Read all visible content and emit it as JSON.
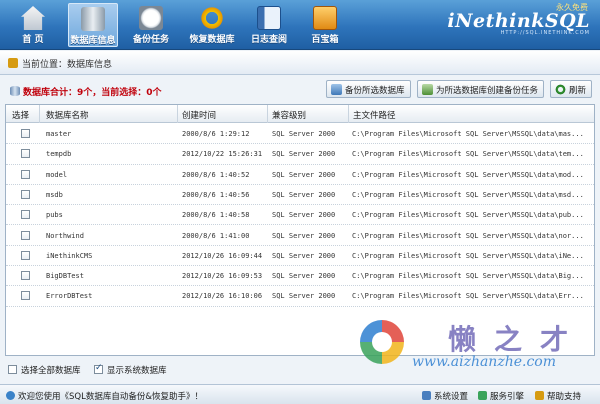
{
  "toolbar": {
    "items": [
      {
        "label": "首 页",
        "icon": "home-icon"
      },
      {
        "label": "数据库信息",
        "icon": "database-icon",
        "active": true
      },
      {
        "label": "备份任务",
        "icon": "clock-icon"
      },
      {
        "label": "恢复数据库",
        "icon": "restore-icon"
      },
      {
        "label": "日志查阅",
        "icon": "log-icon"
      },
      {
        "label": "百宝箱",
        "icon": "toolbox-icon"
      }
    ]
  },
  "brand": {
    "name": "iNethinkSQL",
    "slogan": "永久免费",
    "url": "HTTP://SQL.INETHINK.COM"
  },
  "location": {
    "text": "当前位置：数据库信息"
  },
  "summary": {
    "text": "数据库合计：9个，当前选择：0个"
  },
  "actions": {
    "backup_selected": "备份所选数据库",
    "create_task": "为所选数据库创建备份任务",
    "refresh": "刷新"
  },
  "table": {
    "columns": [
      "选择",
      "数据库名称",
      "创建时间",
      "兼容级别",
      "主文件路径"
    ],
    "rows": [
      {
        "name": "master",
        "created": "2000/8/6 1:29:12",
        "level": "SQL Server 2000",
        "path": "C:\\Program Files\\Microsoft SQL Server\\MSSQL\\data\\mas..."
      },
      {
        "name": "tempdb",
        "created": "2012/10/22 15:26:31",
        "level": "SQL Server 2000",
        "path": "C:\\Program Files\\Microsoft SQL Server\\MSSQL\\data\\tem..."
      },
      {
        "name": "model",
        "created": "2000/8/6 1:40:52",
        "level": "SQL Server 2000",
        "path": "C:\\Program Files\\Microsoft SQL Server\\MSSQL\\data\\mod..."
      },
      {
        "name": "msdb",
        "created": "2000/8/6 1:40:56",
        "level": "SQL Server 2000",
        "path": "C:\\Program Files\\Microsoft SQL Server\\MSSQL\\data\\msd..."
      },
      {
        "name": "pubs",
        "created": "2000/8/6 1:40:58",
        "level": "SQL Server 2000",
        "path": "C:\\Program Files\\Microsoft SQL Server\\MSSQL\\data\\pub..."
      },
      {
        "name": "Northwind",
        "created": "2000/8/6 1:41:00",
        "level": "SQL Server 2000",
        "path": "C:\\Program Files\\Microsoft SQL Server\\MSSQL\\data\\nor..."
      },
      {
        "name": "iNethinkCMS",
        "created": "2012/10/26 16:09:44",
        "level": "SQL Server 2000",
        "path": "C:\\Program Files\\Microsoft SQL Server\\MSSQL\\data\\iNe..."
      },
      {
        "name": "BigDBTest",
        "created": "2012/10/26 16:09:53",
        "level": "SQL Server 2000",
        "path": "C:\\Program Files\\Microsoft SQL Server\\MSSQL\\data\\Big..."
      },
      {
        "name": "ErrorDBTest",
        "created": "2012/10/26 16:10:06",
        "level": "SQL Server 2000",
        "path": "C:\\Program Files\\Microsoft SQL Server\\MSSQL\\data\\Err..."
      }
    ]
  },
  "options": {
    "select_all": {
      "label": "选择全部数据库",
      "checked": false
    },
    "show_system": {
      "label": "显示系统数据库",
      "checked": true
    }
  },
  "watermark": {
    "chars": "懒之才",
    "url": "www.aizhanzhe.com"
  },
  "status": {
    "message": "欢迎您使用《SQL数据库自动备份&恢复助手》！",
    "links": [
      "系统设置",
      "服务引擎",
      "帮助支持"
    ]
  },
  "colors": {
    "accent": "#2e74bb",
    "alert": "#c0000b"
  }
}
